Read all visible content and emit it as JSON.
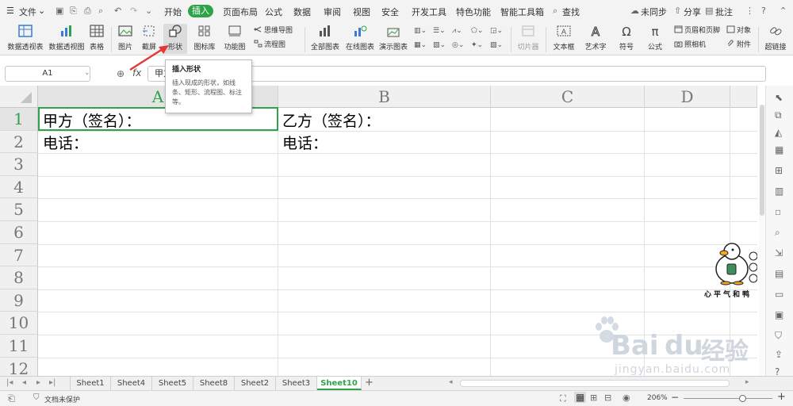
{
  "menu": {
    "file": "文件",
    "tabs": [
      "开始",
      "插入",
      "页面布局",
      "公式",
      "数据",
      "审阅",
      "视图",
      "安全",
      "开发工具",
      "特色功能",
      "智能工具箱"
    ],
    "active_tab": "插入",
    "search": "查找",
    "sync": "未同步",
    "share": "分享",
    "comment": "批注"
  },
  "ribbon": {
    "pivot_table": "数据透视表",
    "pivot_chart": "数据透视图",
    "table": "表格",
    "picture": "图片",
    "screenshot": "截屏",
    "shape": "形状",
    "icon_library": "图标库",
    "function_chart": "功能图",
    "mind_map": "思维导图",
    "flowchart": "流程图",
    "all_charts": "全部图表",
    "online_chart": "在线图表",
    "demo_chart": "演示图表",
    "slicer": "切片器",
    "text_box": "文本框",
    "word_art": "艺术字",
    "symbol": "符号",
    "formula": "公式",
    "header_footer": "页眉和页脚",
    "camera": "照相机",
    "object": "对象",
    "attachment": "附件",
    "hyperlink": "超链接"
  },
  "formula_bar": {
    "name_box": "A1",
    "fx": "fx",
    "content": "甲方"
  },
  "tooltip": {
    "title": "插入形状",
    "description": "插入现成的形状，如线条、矩形、流程图、标注等。"
  },
  "sheet": {
    "columns": [
      "A",
      "B",
      "C",
      "D"
    ],
    "rows": [
      "1",
      "2",
      "3",
      "4",
      "5",
      "6",
      "7",
      "8",
      "9",
      "10",
      "11",
      "12"
    ],
    "cells": {
      "A1": "甲方（签名）：",
      "A2": "电话：",
      "B1": "乙方（签名）：",
      "B2": "电话："
    }
  },
  "sheet_tabs": [
    "Sheet1",
    "Sheet4",
    "Sheet5",
    "Sheet8",
    "Sheet2",
    "Sheet3",
    "Sheet10"
  ],
  "active_sheet": "Sheet10",
  "status": {
    "protection": "文档未保护",
    "zoom": "206%"
  },
  "watermark": {
    "stamp_text": "心平气和鸭",
    "baidu": "Bai",
    "baidu2": "du",
    "jingyan": "经验",
    "url": "jingyan.baidu.com"
  },
  "colors": {
    "accent": "#2ea34a",
    "arrow": "#e53935"
  }
}
